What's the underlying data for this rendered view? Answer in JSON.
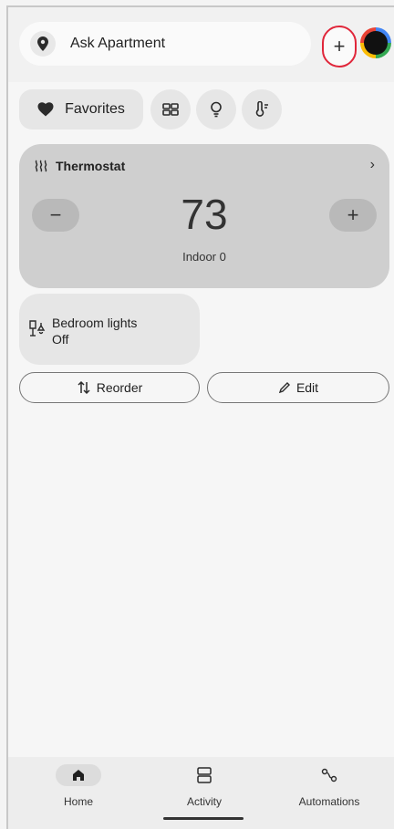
{
  "header": {
    "search_label": "Ask Apartment",
    "add_label": "+",
    "accent": "#e0263a"
  },
  "chips": {
    "favorites_label": "Favorites"
  },
  "thermostat": {
    "title": "Thermostat",
    "minus_label": "−",
    "plus_label": "+",
    "temperature": "73",
    "status": "Indoor 0",
    "chevron": "›"
  },
  "lights": {
    "name": "Bedroom lights",
    "state": "Off"
  },
  "actions": {
    "reorder_label": "Reorder",
    "edit_label": "Edit"
  },
  "nav": {
    "home_label": "Home",
    "activity_label": "Activity",
    "automations_label": "Automations"
  },
  "icons": [
    "location-pin-icon",
    "heart-icon",
    "grid-icon",
    "bulb-icon",
    "thermometer-icon",
    "heat-icon",
    "light-switch-icon",
    "reorder-icon",
    "pencil-icon",
    "home-icon",
    "activity-icon",
    "automations-icon"
  ]
}
